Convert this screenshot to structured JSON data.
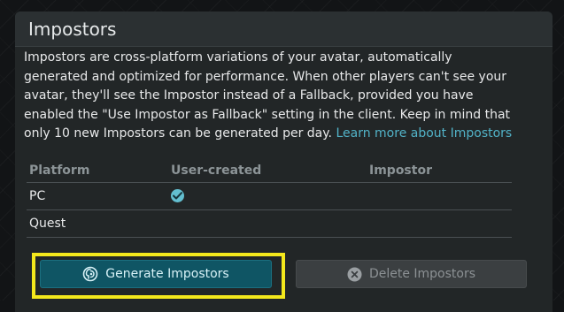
{
  "panel": {
    "title": "Impostors"
  },
  "description": {
    "text": "Impostors are cross-platform variations of your avatar, automatically generated and optimized for performance. When other players can't see your avatar, they'll see the Impostor instead of a Fallback, provided you have enabled the \"Use Impostor as Fallback\" setting in the client. Keep in mind that only 10 new Impostors can be generated per day.",
    "link_label": "Learn more about Impostors"
  },
  "table": {
    "headers": [
      "Platform",
      "User-created",
      "Impostor"
    ],
    "rows": [
      {
        "platform": "PC",
        "user_created": true,
        "impostor": ""
      },
      {
        "platform": "Quest",
        "user_created": false,
        "impostor": ""
      }
    ]
  },
  "buttons": {
    "generate_label": "Generate Impostors",
    "delete_label": "Delete Impostors"
  },
  "colors": {
    "accent": "#52b3c8",
    "highlight": "#f4e81c",
    "generate_bg": "#0f5564",
    "delete_bg": "#3b3f41"
  }
}
